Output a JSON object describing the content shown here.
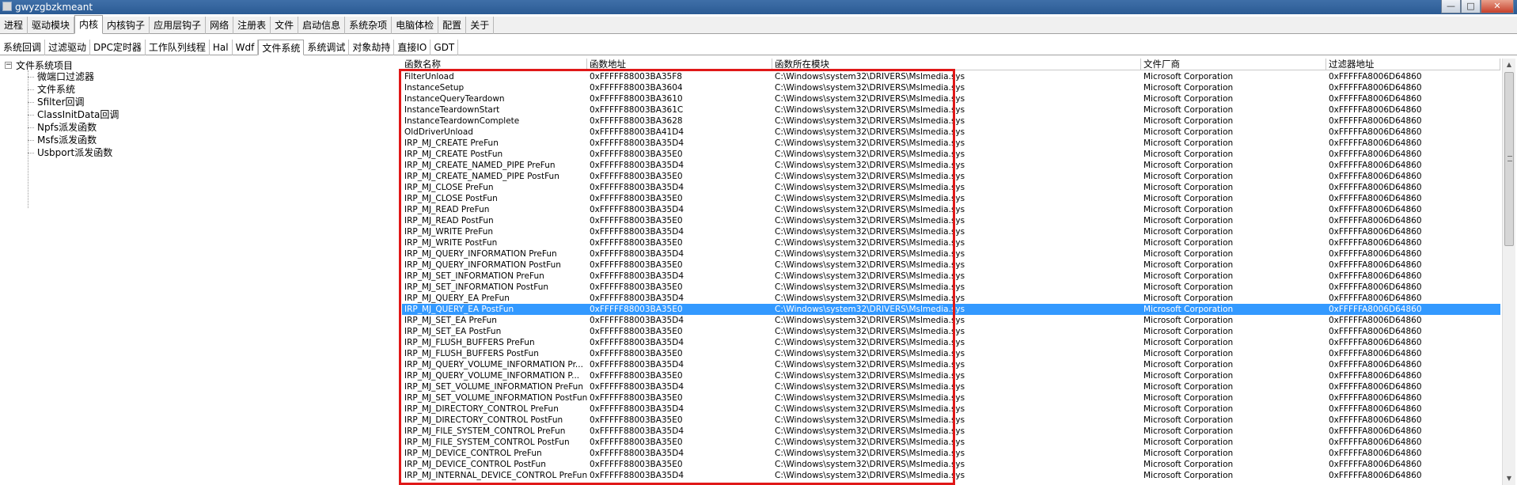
{
  "window": {
    "title": "gwyzgbzkmeant",
    "controls": {
      "minimize": "—",
      "maximize": "□",
      "close": "✕"
    }
  },
  "main_tabs": [
    "进程",
    "驱动模块",
    "内核",
    "内核钩子",
    "应用层钩子",
    "网络",
    "注册表",
    "文件",
    "启动信息",
    "系统杂项",
    "电脑体检",
    "配置",
    "关于"
  ],
  "main_tab_active": "内核",
  "sub_tabs": [
    "系统回调",
    "过滤驱动",
    "DPC定时器",
    "工作队列线程",
    "Hal",
    "Wdf",
    "文件系统",
    "系统调试",
    "对象劫持",
    "直接IO",
    "GDT"
  ],
  "sub_tab_active": "文件系统",
  "tree": {
    "root": "文件系统项目",
    "expander": "−",
    "children": [
      "微端口过滤器",
      "文件系统",
      "Sfilter回调",
      "ClassInitData回调",
      "Npfs派发函数",
      "Msfs派发函数",
      "Usbport派发函数"
    ]
  },
  "grid": {
    "columns": [
      "函数名称",
      "函数地址",
      "函数所在模块",
      "文件厂商",
      "过滤器地址"
    ],
    "selected_row": 21,
    "rows": [
      [
        "FilterUnload",
        "0xFFFFF88003BA35F8",
        "C:\\Windows\\system32\\DRIVERS\\Mslmedia.sys",
        "Microsoft Corporation",
        "0xFFFFFA8006D64860"
      ],
      [
        "InstanceSetup",
        "0xFFFFF88003BA3604",
        "C:\\Windows\\system32\\DRIVERS\\Mslmedia.sys",
        "Microsoft Corporation",
        "0xFFFFFA8006D64860"
      ],
      [
        "InstanceQueryTeardown",
        "0xFFFFF88003BA3610",
        "C:\\Windows\\system32\\DRIVERS\\Mslmedia.sys",
        "Microsoft Corporation",
        "0xFFFFFA8006D64860"
      ],
      [
        "InstanceTeardownStart",
        "0xFFFFF88003BA361C",
        "C:\\Windows\\system32\\DRIVERS\\Mslmedia.sys",
        "Microsoft Corporation",
        "0xFFFFFA8006D64860"
      ],
      [
        "InstanceTeardownComplete",
        "0xFFFFF88003BA3628",
        "C:\\Windows\\system32\\DRIVERS\\Mslmedia.sys",
        "Microsoft Corporation",
        "0xFFFFFA8006D64860"
      ],
      [
        "OldDriverUnload",
        "0xFFFFF88003BA41D4",
        "C:\\Windows\\system32\\DRIVERS\\Mslmedia.sys",
        "Microsoft Corporation",
        "0xFFFFFA8006D64860"
      ],
      [
        "IRP_MJ_CREATE PreFun",
        "0xFFFFF88003BA35D4",
        "C:\\Windows\\system32\\DRIVERS\\Mslmedia.sys",
        "Microsoft Corporation",
        "0xFFFFFA8006D64860"
      ],
      [
        "IRP_MJ_CREATE PostFun",
        "0xFFFFF88003BA35E0",
        "C:\\Windows\\system32\\DRIVERS\\Mslmedia.sys",
        "Microsoft Corporation",
        "0xFFFFFA8006D64860"
      ],
      [
        "IRP_MJ_CREATE_NAMED_PIPE PreFun",
        "0xFFFFF88003BA35D4",
        "C:\\Windows\\system32\\DRIVERS\\Mslmedia.sys",
        "Microsoft Corporation",
        "0xFFFFFA8006D64860"
      ],
      [
        "IRP_MJ_CREATE_NAMED_PIPE PostFun",
        "0xFFFFF88003BA35E0",
        "C:\\Windows\\system32\\DRIVERS\\Mslmedia.sys",
        "Microsoft Corporation",
        "0xFFFFFA8006D64860"
      ],
      [
        "IRP_MJ_CLOSE PreFun",
        "0xFFFFF88003BA35D4",
        "C:\\Windows\\system32\\DRIVERS\\Mslmedia.sys",
        "Microsoft Corporation",
        "0xFFFFFA8006D64860"
      ],
      [
        "IRP_MJ_CLOSE PostFun",
        "0xFFFFF88003BA35E0",
        "C:\\Windows\\system32\\DRIVERS\\Mslmedia.sys",
        "Microsoft Corporation",
        "0xFFFFFA8006D64860"
      ],
      [
        "IRP_MJ_READ PreFun",
        "0xFFFFF88003BA35D4",
        "C:\\Windows\\system32\\DRIVERS\\Mslmedia.sys",
        "Microsoft Corporation",
        "0xFFFFFA8006D64860"
      ],
      [
        "IRP_MJ_READ PostFun",
        "0xFFFFF88003BA35E0",
        "C:\\Windows\\system32\\DRIVERS\\Mslmedia.sys",
        "Microsoft Corporation",
        "0xFFFFFA8006D64860"
      ],
      [
        "IRP_MJ_WRITE PreFun",
        "0xFFFFF88003BA35D4",
        "C:\\Windows\\system32\\DRIVERS\\Mslmedia.sys",
        "Microsoft Corporation",
        "0xFFFFFA8006D64860"
      ],
      [
        "IRP_MJ_WRITE PostFun",
        "0xFFFFF88003BA35E0",
        "C:\\Windows\\system32\\DRIVERS\\Mslmedia.sys",
        "Microsoft Corporation",
        "0xFFFFFA8006D64860"
      ],
      [
        "IRP_MJ_QUERY_INFORMATION PreFun",
        "0xFFFFF88003BA35D4",
        "C:\\Windows\\system32\\DRIVERS\\Mslmedia.sys",
        "Microsoft Corporation",
        "0xFFFFFA8006D64860"
      ],
      [
        "IRP_MJ_QUERY_INFORMATION PostFun",
        "0xFFFFF88003BA35E0",
        "C:\\Windows\\system32\\DRIVERS\\Mslmedia.sys",
        "Microsoft Corporation",
        "0xFFFFFA8006D64860"
      ],
      [
        "IRP_MJ_SET_INFORMATION PreFun",
        "0xFFFFF88003BA35D4",
        "C:\\Windows\\system32\\DRIVERS\\Mslmedia.sys",
        "Microsoft Corporation",
        "0xFFFFFA8006D64860"
      ],
      [
        "IRP_MJ_SET_INFORMATION PostFun",
        "0xFFFFF88003BA35E0",
        "C:\\Windows\\system32\\DRIVERS\\Mslmedia.sys",
        "Microsoft Corporation",
        "0xFFFFFA8006D64860"
      ],
      [
        "IRP_MJ_QUERY_EA PreFun",
        "0xFFFFF88003BA35D4",
        "C:\\Windows\\system32\\DRIVERS\\Mslmedia.sys",
        "Microsoft Corporation",
        "0xFFFFFA8006D64860"
      ],
      [
        "IRP_MJ_QUERY_EA PostFun",
        "0xFFFFF88003BA35E0",
        "C:\\Windows\\system32\\DRIVERS\\Mslmedia.sys",
        "Microsoft Corporation",
        "0xFFFFFA8006D64860"
      ],
      [
        "IRP_MJ_SET_EA PreFun",
        "0xFFFFF88003BA35D4",
        "C:\\Windows\\system32\\DRIVERS\\Mslmedia.sys",
        "Microsoft Corporation",
        "0xFFFFFA8006D64860"
      ],
      [
        "IRP_MJ_SET_EA PostFun",
        "0xFFFFF88003BA35E0",
        "C:\\Windows\\system32\\DRIVERS\\Mslmedia.sys",
        "Microsoft Corporation",
        "0xFFFFFA8006D64860"
      ],
      [
        "IRP_MJ_FLUSH_BUFFERS PreFun",
        "0xFFFFF88003BA35D4",
        "C:\\Windows\\system32\\DRIVERS\\Mslmedia.sys",
        "Microsoft Corporation",
        "0xFFFFFA8006D64860"
      ],
      [
        "IRP_MJ_FLUSH_BUFFERS PostFun",
        "0xFFFFF88003BA35E0",
        "C:\\Windows\\system32\\DRIVERS\\Mslmedia.sys",
        "Microsoft Corporation",
        "0xFFFFFA8006D64860"
      ],
      [
        "IRP_MJ_QUERY_VOLUME_INFORMATION Pr...",
        "0xFFFFF88003BA35D4",
        "C:\\Windows\\system32\\DRIVERS\\Mslmedia.sys",
        "Microsoft Corporation",
        "0xFFFFFA8006D64860"
      ],
      [
        "IRP_MJ_QUERY_VOLUME_INFORMATION P...",
        "0xFFFFF88003BA35E0",
        "C:\\Windows\\system32\\DRIVERS\\Mslmedia.sys",
        "Microsoft Corporation",
        "0xFFFFFA8006D64860"
      ],
      [
        "IRP_MJ_SET_VOLUME_INFORMATION PreFun",
        "0xFFFFF88003BA35D4",
        "C:\\Windows\\system32\\DRIVERS\\Mslmedia.sys",
        "Microsoft Corporation",
        "0xFFFFFA8006D64860"
      ],
      [
        "IRP_MJ_SET_VOLUME_INFORMATION PostFun",
        "0xFFFFF88003BA35E0",
        "C:\\Windows\\system32\\DRIVERS\\Mslmedia.sys",
        "Microsoft Corporation",
        "0xFFFFFA8006D64860"
      ],
      [
        "IRP_MJ_DIRECTORY_CONTROL PreFun",
        "0xFFFFF88003BA35D4",
        "C:\\Windows\\system32\\DRIVERS\\Mslmedia.sys",
        "Microsoft Corporation",
        "0xFFFFFA8006D64860"
      ],
      [
        "IRP_MJ_DIRECTORY_CONTROL PostFun",
        "0xFFFFF88003BA35E0",
        "C:\\Windows\\system32\\DRIVERS\\Mslmedia.sys",
        "Microsoft Corporation",
        "0xFFFFFA8006D64860"
      ],
      [
        "IRP_MJ_FILE_SYSTEM_CONTROL PreFun",
        "0xFFFFF88003BA35D4",
        "C:\\Windows\\system32\\DRIVERS\\Mslmedia.sys",
        "Microsoft Corporation",
        "0xFFFFFA8006D64860"
      ],
      [
        "IRP_MJ_FILE_SYSTEM_CONTROL PostFun",
        "0xFFFFF88003BA35E0",
        "C:\\Windows\\system32\\DRIVERS\\Mslmedia.sys",
        "Microsoft Corporation",
        "0xFFFFFA8006D64860"
      ],
      [
        "IRP_MJ_DEVICE_CONTROL PreFun",
        "0xFFFFF88003BA35D4",
        "C:\\Windows\\system32\\DRIVERS\\Mslmedia.sys",
        "Microsoft Corporation",
        "0xFFFFFA8006D64860"
      ],
      [
        "IRP_MJ_DEVICE_CONTROL PostFun",
        "0xFFFFF88003BA35E0",
        "C:\\Windows\\system32\\DRIVERS\\Mslmedia.sys",
        "Microsoft Corporation",
        "0xFFFFFA8006D64860"
      ],
      [
        "IRP_MJ_INTERNAL_DEVICE_CONTROL PreFun",
        "0xFFFFF88003BA35D4",
        "C:\\Windows\\system32\\DRIVERS\\Mslmedia.sys",
        "Microsoft Corporation",
        "0xFFFFFA8006D64860"
      ]
    ]
  },
  "scrollbar": {
    "up_arrow": "▲",
    "down_arrow": "▼"
  },
  "colors": {
    "selection": "#3399ff",
    "highlight_box": "#e01818",
    "titlebar": "#2b5b94"
  },
  "icons": [
    "app-icon",
    "minimize-icon",
    "maximize-icon",
    "close-icon",
    "tree-expander-icon",
    "scroll-up-icon",
    "scroll-down-icon"
  ]
}
